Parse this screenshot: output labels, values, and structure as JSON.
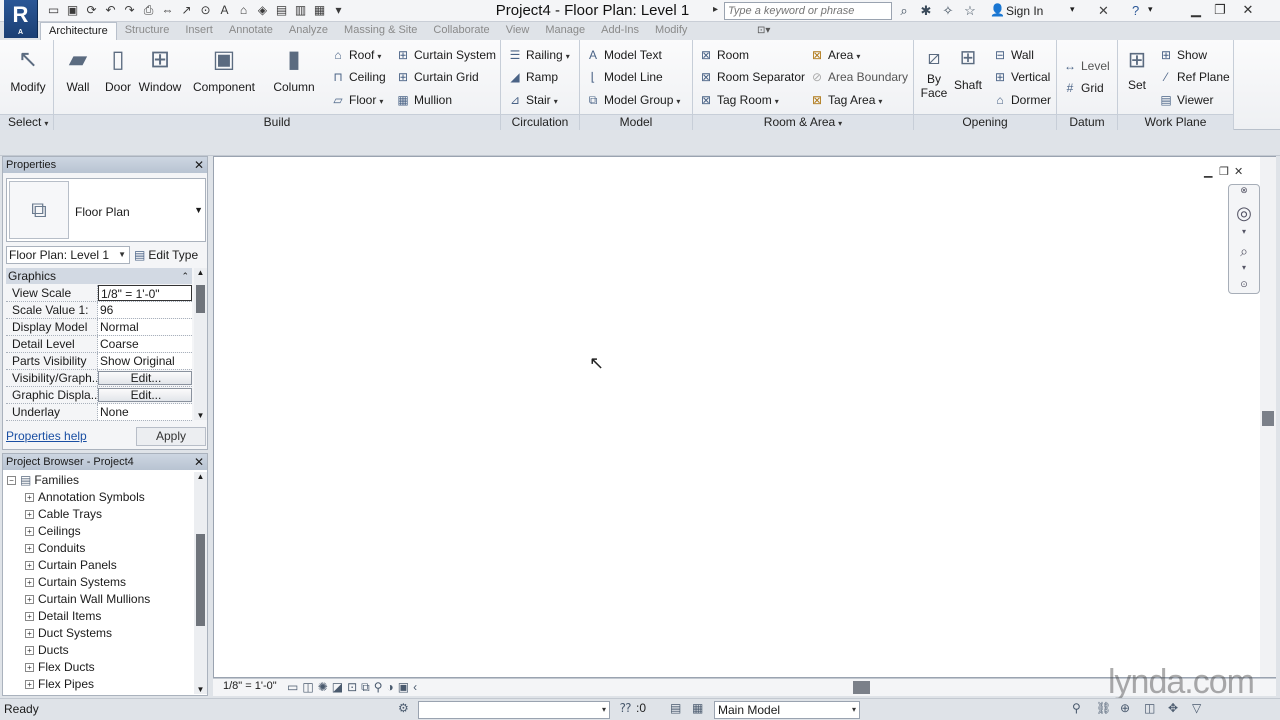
{
  "app": {
    "logo_letter": "R",
    "logo_sub": "A"
  },
  "titlebar": {
    "document_title": "Project4 - Floor Plan: Level 1",
    "search_placeholder": "Type a keyword or phrase",
    "sign_in": "Sign In"
  },
  "tabs": [
    {
      "label": "Architecture"
    },
    {
      "label": "Structure"
    },
    {
      "label": "Insert"
    },
    {
      "label": "Annotate"
    },
    {
      "label": "Analyze"
    },
    {
      "label": "Massing & Site"
    },
    {
      "label": "Collaborate"
    },
    {
      "label": "View"
    },
    {
      "label": "Manage"
    },
    {
      "label": "Add-Ins"
    },
    {
      "label": "Modify"
    }
  ],
  "ribbon": {
    "select": {
      "modify": "Modify",
      "label": "Select"
    },
    "build": {
      "label": "Build",
      "wall": "Wall",
      "door": "Door",
      "window": "Window",
      "component": "Component",
      "column": "Column",
      "roof": "Roof",
      "ceiling": "Ceiling",
      "floor": "Floor",
      "curtain_system": "Curtain System",
      "curtain_grid": "Curtain Grid",
      "mullion": "Mullion"
    },
    "circulation": {
      "label": "Circulation",
      "railing": "Railing",
      "ramp": "Ramp",
      "stair": "Stair"
    },
    "model": {
      "label": "Model",
      "model_text": "Model Text",
      "model_line": "Model Line",
      "model_group": "Model Group"
    },
    "room_area": {
      "label": "Room & Area",
      "room": "Room",
      "room_separator": "Room Separator",
      "tag_room": "Tag Room",
      "area": "Area",
      "area_boundary": "Area Boundary",
      "tag_area": "Tag Area"
    },
    "opening": {
      "label": "Opening",
      "by_face": "By Face",
      "shaft": "Shaft",
      "wall": "Wall",
      "vertical": "Vertical",
      "dormer": "Dormer"
    },
    "datum": {
      "label": "Datum",
      "level": "Level",
      "grid": "Grid"
    },
    "work_plane": {
      "label": "Work Plane",
      "set": "Set",
      "show": "Show",
      "ref_plane": "Ref Plane",
      "viewer": "Viewer"
    }
  },
  "properties": {
    "title": "Properties",
    "type_name": "Floor Plan",
    "view_selector": "Floor Plan: Level 1",
    "edit_type": "Edit Type",
    "category": "Graphics",
    "rows": [
      {
        "name": "View Scale",
        "value": "1/8\" = 1'-0\""
      },
      {
        "name": "Scale Value    1:",
        "value": "96"
      },
      {
        "name": "Display Model",
        "value": "Normal"
      },
      {
        "name": "Detail Level",
        "value": "Coarse"
      },
      {
        "name": "Parts Visibility",
        "value": "Show Original"
      },
      {
        "name": "Visibility/Graph...",
        "value": "Edit..."
      },
      {
        "name": "Graphic Displa...",
        "value": "Edit..."
      },
      {
        "name": "Underlay",
        "value": "None"
      }
    ],
    "help_link": "Properties help",
    "apply": "Apply"
  },
  "browser": {
    "title": "Project Browser - Project4",
    "root": "Families",
    "items": [
      {
        "label": "Annotation Symbols"
      },
      {
        "label": "Cable Trays"
      },
      {
        "label": "Ceilings"
      },
      {
        "label": "Conduits"
      },
      {
        "label": "Curtain Panels"
      },
      {
        "label": "Curtain Systems"
      },
      {
        "label": "Curtain Wall Mullions"
      },
      {
        "label": "Detail Items"
      },
      {
        "label": "Duct Systems"
      },
      {
        "label": "Ducts"
      },
      {
        "label": "Flex Ducts"
      },
      {
        "label": "Flex Pipes"
      }
    ]
  },
  "viewbar": {
    "scale": "1/8\" = 1'-0\"",
    "watermark": "lynda.com"
  },
  "statusbar": {
    "status": "Ready",
    "worksets": ":0",
    "active_model": "Main Model"
  },
  "colors": {
    "ribbon_bg": "#f4f5f7",
    "panel_label_bg": "#dde2e9",
    "logo_blue": "#2b5796",
    "link": "#1a4fa3"
  }
}
